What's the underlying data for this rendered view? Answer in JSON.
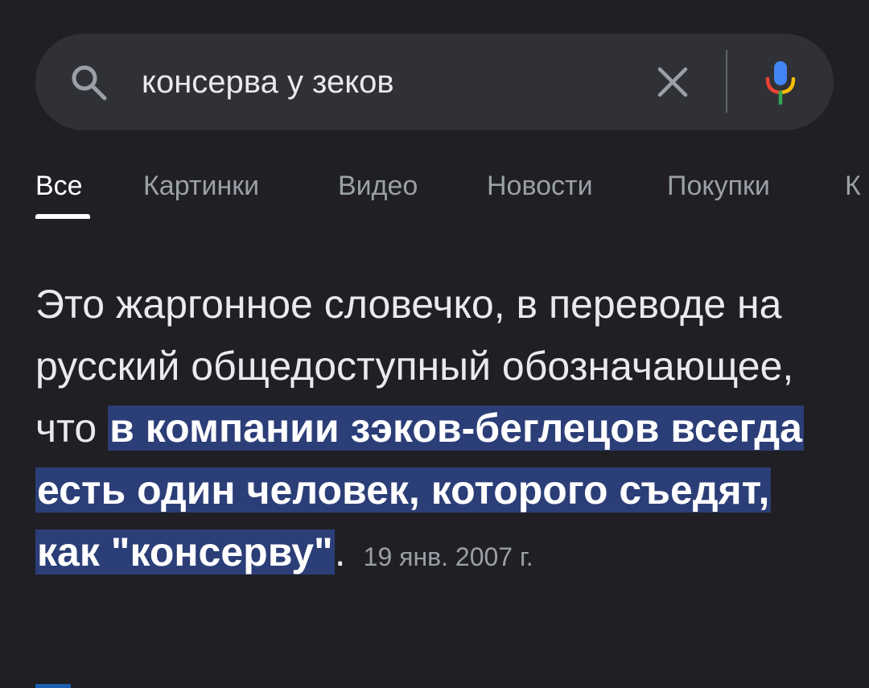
{
  "search": {
    "query": "консерва у зеков",
    "icons": {
      "search": "search-icon",
      "clear": "close-icon",
      "voice": "mic-icon"
    }
  },
  "tabs": [
    {
      "label": "Все",
      "active": true
    },
    {
      "label": "Картинки",
      "active": false
    },
    {
      "label": "Видео",
      "active": false
    },
    {
      "label": "Новости",
      "active": false
    },
    {
      "label": "Покупки",
      "active": false
    },
    {
      "label": "К",
      "active": false
    }
  ],
  "answer": {
    "text_plain": "Это жаргонное словечко, в переводе на русский общедоступный обозначающее, что ",
    "text_highlight": "в компании зэков-беглецов всегда есть один человек, которого съедят, как \"консерву\"",
    "text_end": ".",
    "date": "19 янв. 2007 г."
  },
  "colors": {
    "background": "#1f1f24",
    "search_bg": "#303136",
    "highlight_bg": "#2c3e77",
    "tab_inactive": "#9aa0a6",
    "mic_blue": "#4285f4",
    "mic_red": "#ea4335",
    "mic_yellow": "#fbbc05",
    "mic_green": "#34a853"
  }
}
